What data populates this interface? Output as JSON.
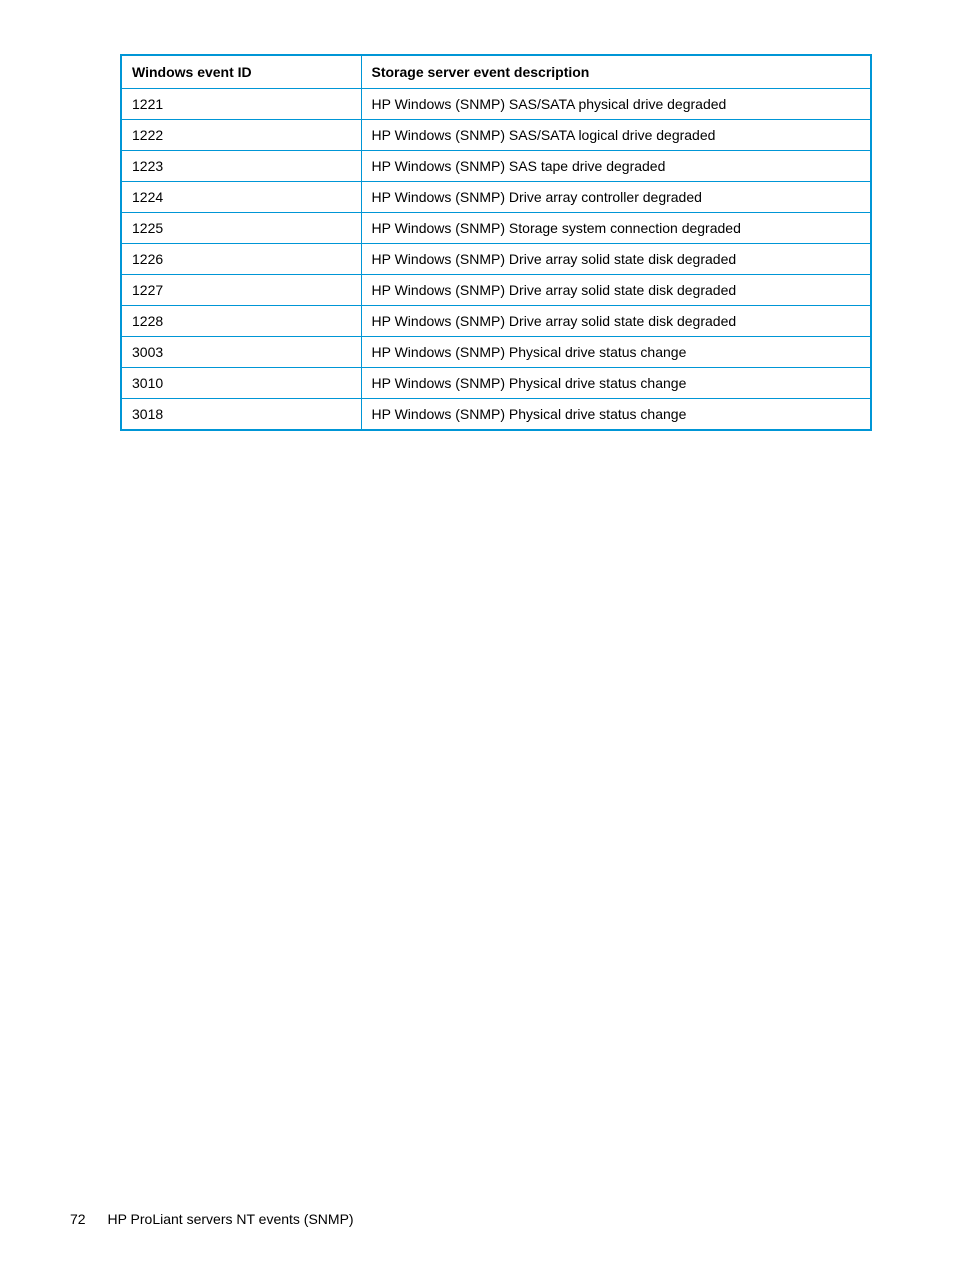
{
  "table": {
    "headers": {
      "col1": "Windows event ID",
      "col2": "Storage server event description"
    },
    "rows": [
      {
        "id": "1221",
        "desc": "HP Windows (SNMP) SAS/SATA physical drive degraded"
      },
      {
        "id": "1222",
        "desc": "HP Windows (SNMP) SAS/SATA logical drive degraded"
      },
      {
        "id": "1223",
        "desc": "HP Windows (SNMP) SAS tape drive degraded"
      },
      {
        "id": "1224",
        "desc": "HP Windows (SNMP) Drive array controller degraded"
      },
      {
        "id": "1225",
        "desc": "HP Windows (SNMP) Storage system connection degraded"
      },
      {
        "id": "1226",
        "desc": "HP Windows (SNMP) Drive array solid state disk degraded"
      },
      {
        "id": "1227",
        "desc": "HP Windows (SNMP) Drive array solid state disk degraded"
      },
      {
        "id": "1228",
        "desc": "HP Windows (SNMP) Drive array solid state disk degraded"
      },
      {
        "id": "3003",
        "desc": "HP Windows (SNMP) Physical drive status change"
      },
      {
        "id": "3010",
        "desc": "HP Windows (SNMP) Physical drive status change"
      },
      {
        "id": "3018",
        "desc": "HP Windows (SNMP) Physical drive status change"
      }
    ]
  },
  "footer": {
    "page_number": "72",
    "section_title": "HP ProLiant servers NT events (SNMP)"
  }
}
